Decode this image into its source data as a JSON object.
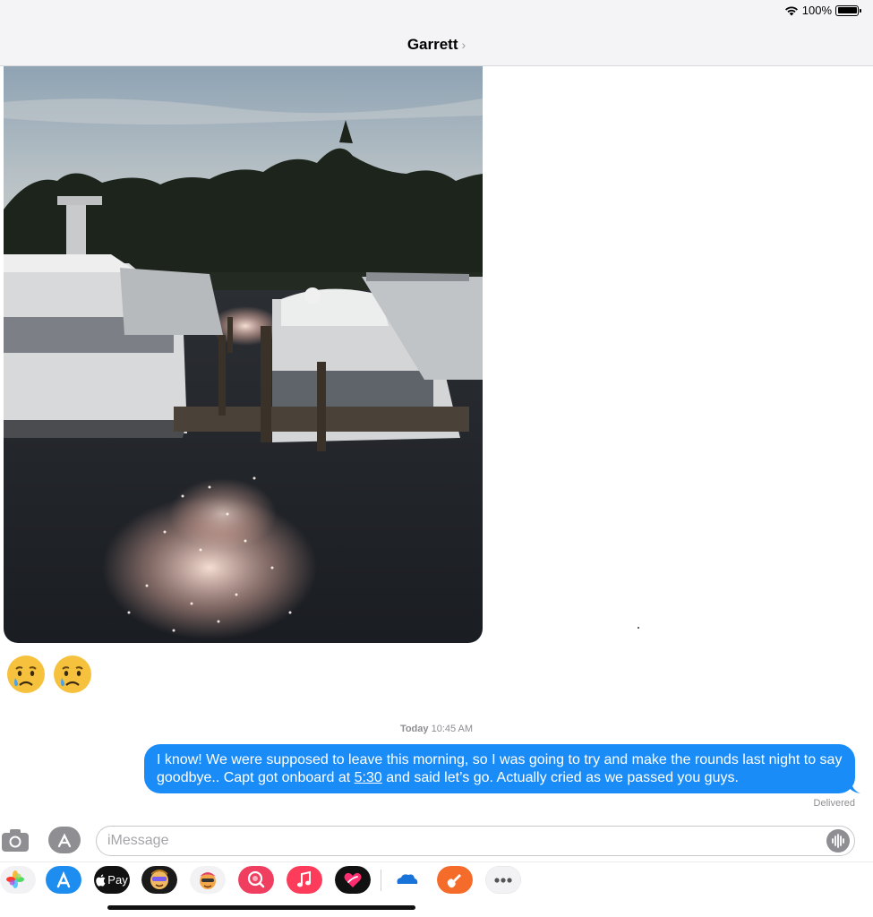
{
  "status_bar": {
    "battery_text": "100%",
    "icons": [
      "wifi-icon",
      "battery-icon"
    ]
  },
  "header": {
    "contact_name": "Garrett",
    "chevron": "›"
  },
  "messages": {
    "received_reactions": [
      "😢",
      "😢"
    ],
    "timestamp_day": "Today",
    "timestamp_time": "10:45 AM",
    "sent": {
      "text_before": "I know! We were supposed to leave this morning, so I was going to try and make the rounds last night to say goodbye.. Capt got onboard at ",
      "link": "5:30",
      "text_after": " and said let’s go. Actually cried as we passed you guys.",
      "status": "Delivered"
    }
  },
  "composer": {
    "placeholder": "iMessage",
    "value": ""
  },
  "app_drawer": {
    "apps": [
      "photos-icon",
      "app-store-icon",
      "apple-pay-icon",
      "memoji-icon",
      "animoji-icon",
      "image-search-icon",
      "music-icon",
      "digital-touch-icon",
      "onedrive-icon",
      "garageband-icon",
      "more-icon"
    ],
    "apple_pay_label": "Pay"
  },
  "colors": {
    "bubble_blue": "#1a8cf7",
    "header_bg": "#f4f4f6",
    "meta_gray": "#8e8e93"
  }
}
